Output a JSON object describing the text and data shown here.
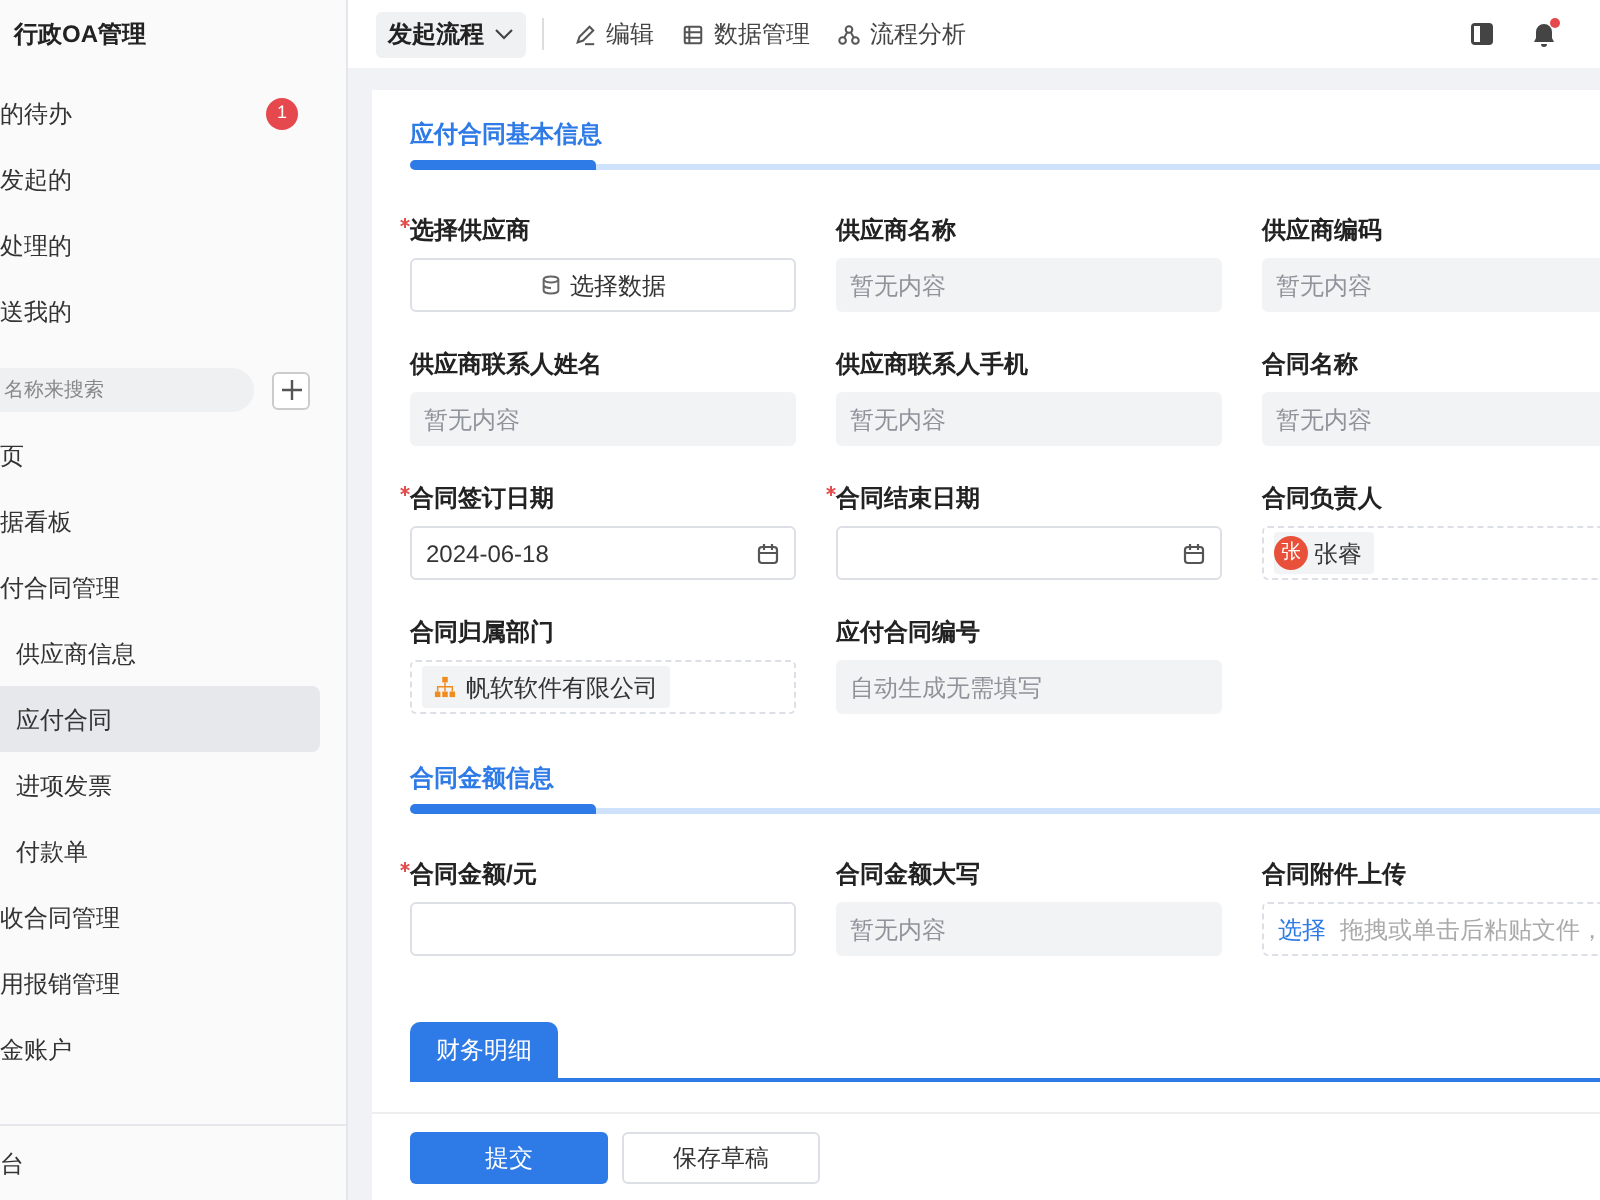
{
  "sidebar": {
    "title": "行政OA管理",
    "quick_items": [
      {
        "label": "的待办",
        "badge": "1"
      },
      {
        "label": "发起的"
      },
      {
        "label": "处理的"
      },
      {
        "label": "送我的"
      }
    ],
    "search": {
      "placeholder": "名称来搜索"
    },
    "items": [
      {
        "label": "页",
        "selected": false
      },
      {
        "label": "据看板",
        "selected": false
      },
      {
        "label": "付合同管理",
        "selected": false,
        "children": [
          {
            "label": "供应商信息",
            "selected": false
          },
          {
            "label": "应付合同",
            "selected": true
          },
          {
            "label": "进项发票",
            "selected": false
          },
          {
            "label": "付款单",
            "selected": false
          }
        ]
      },
      {
        "label": "收合同管理",
        "selected": false
      },
      {
        "label": "用报销管理",
        "selected": false
      },
      {
        "label": "金账户",
        "selected": false
      }
    ],
    "footer": "台"
  },
  "toolbar": {
    "start_button": "发起流程",
    "actions": [
      {
        "kind": "edit",
        "label": "编辑"
      },
      {
        "kind": "data",
        "label": "数据管理"
      },
      {
        "kind": "flow",
        "label": "流程分析"
      }
    ],
    "notification_dot": true
  },
  "sections": [
    {
      "title": "应付合同基本信息",
      "fields": [
        {
          "label": "选择供应商",
          "required": true,
          "kind": "select_button",
          "text": "选择数据"
        },
        {
          "label": "供应商名称",
          "required": false,
          "kind": "readonly",
          "placeholder": "暂无内容"
        },
        {
          "label": "供应商编码",
          "required": false,
          "kind": "readonly",
          "placeholder": "暂无内容"
        },
        {
          "label": "供应商联系人姓名",
          "required": false,
          "kind": "readonly",
          "placeholder": "暂无内容"
        },
        {
          "label": "供应商联系人手机",
          "required": false,
          "kind": "readonly",
          "placeholder": "暂无内容"
        },
        {
          "label": "合同名称",
          "required": false,
          "kind": "readonly",
          "placeholder": "暂无内容"
        },
        {
          "label": "合同签订日期",
          "required": true,
          "kind": "date",
          "value": "2024-06-18"
        },
        {
          "label": "合同结束日期",
          "required": true,
          "kind": "date"
        },
        {
          "label": "合同负责人",
          "required": false,
          "kind": "member",
          "avatar": "张",
          "text": "张睿"
        },
        {
          "label": "合同归属部门",
          "required": false,
          "kind": "department",
          "text": "帆软软件有限公司"
        },
        {
          "label": "应付合同编号",
          "required": false,
          "kind": "readonly",
          "placeholder": "自动生成无需填写"
        }
      ]
    },
    {
      "title": "合同金额信息",
      "fields": [
        {
          "label": "合同金额/元",
          "required": true,
          "kind": "input"
        },
        {
          "label": "合同金额大写",
          "required": false,
          "kind": "readonly",
          "placeholder": "暂无内容"
        },
        {
          "label": "合同附件上传",
          "required": false,
          "kind": "upload",
          "link": "选择",
          "text": "拖拽或单击后粘贴文件，"
        }
      ]
    }
  ],
  "tabs": [
    {
      "label": "财务明细",
      "selected": true
    }
  ],
  "buttons": [
    {
      "kind": "primary",
      "label": "提交"
    },
    {
      "kind": "secondary",
      "label": "保存草稿"
    }
  ]
}
